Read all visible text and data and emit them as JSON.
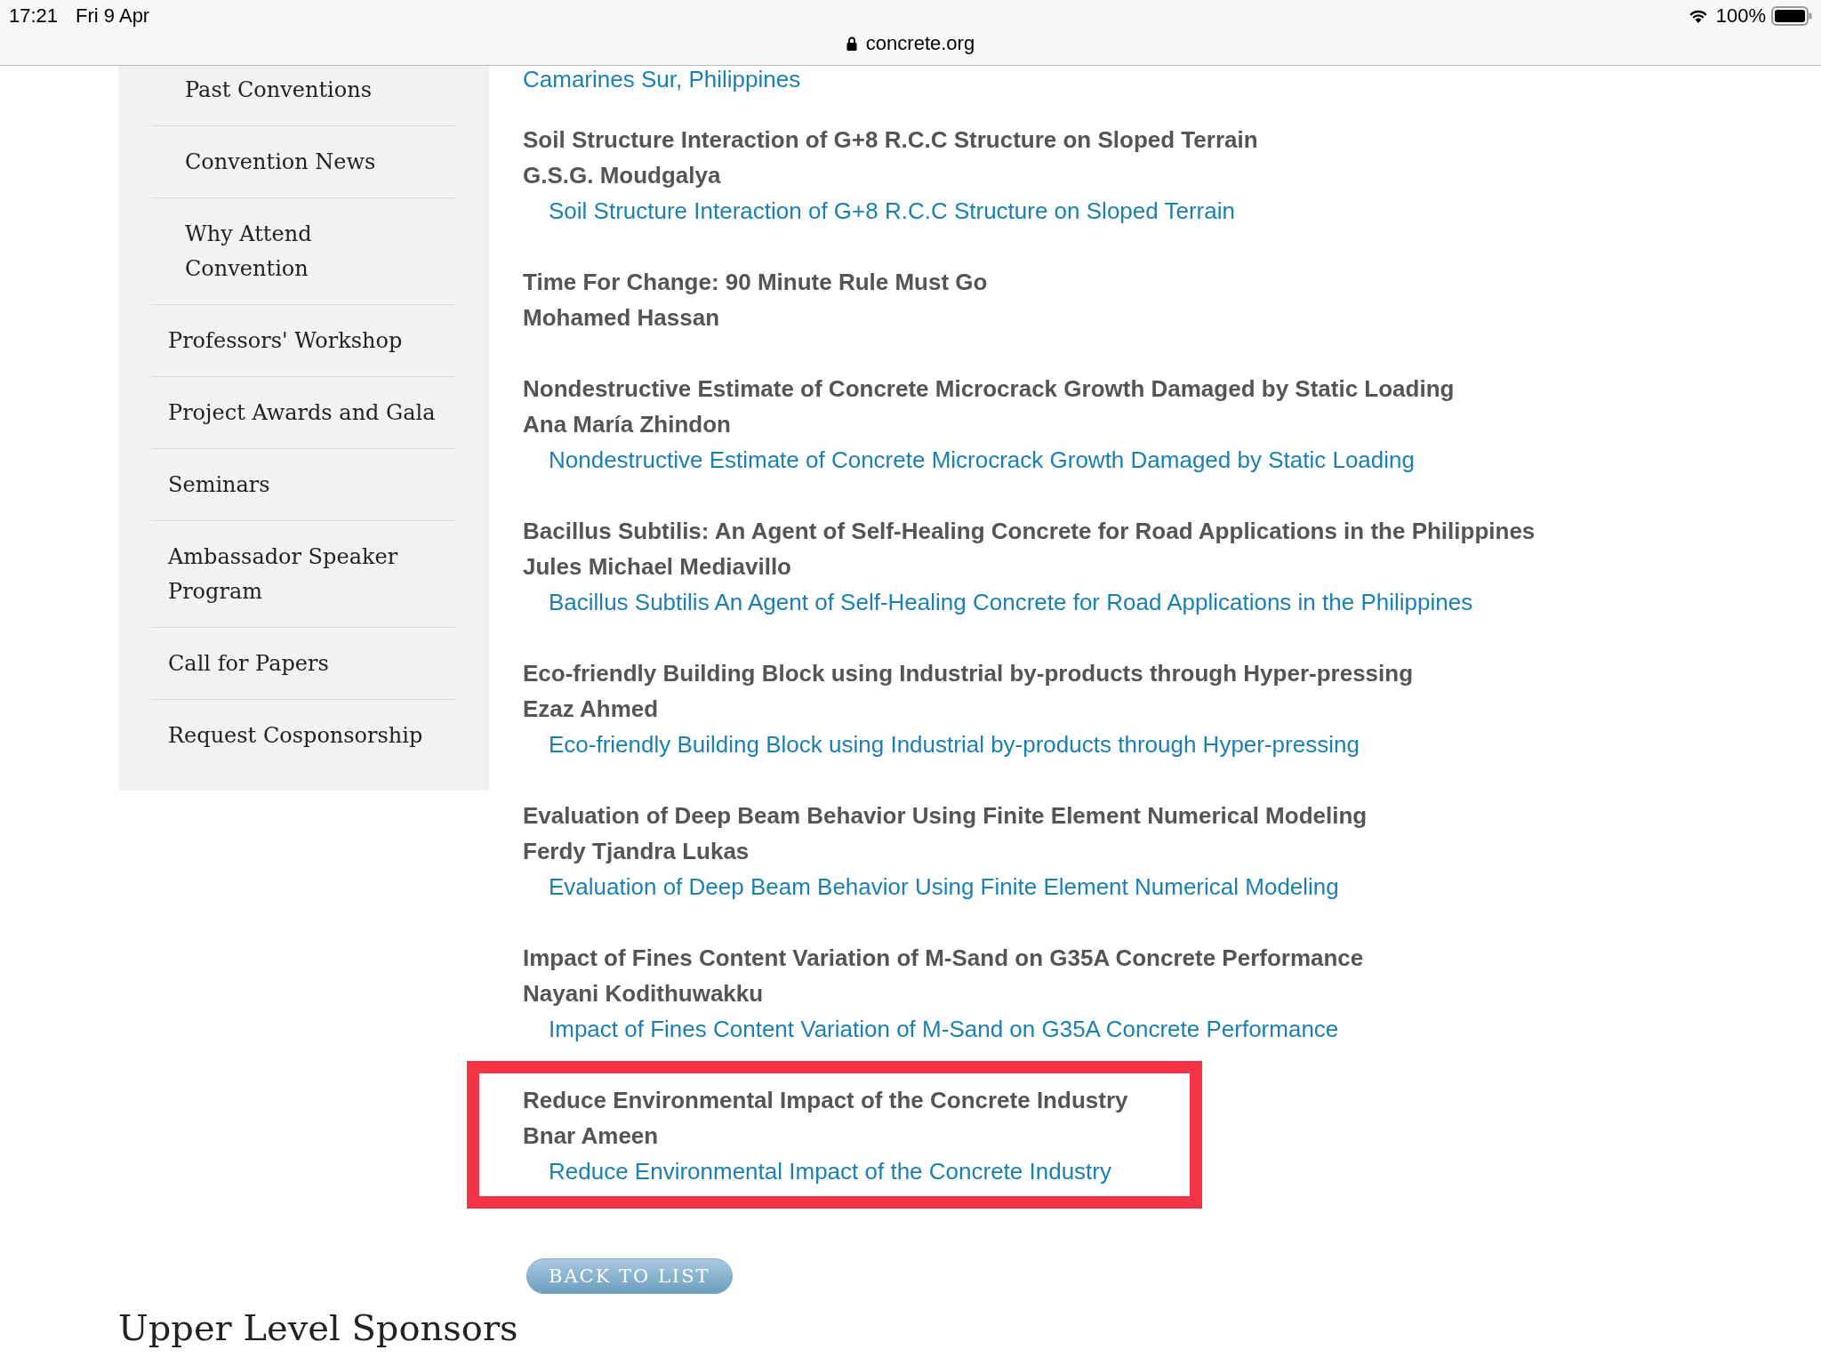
{
  "status_bar": {
    "time": "17:21",
    "date": "Fri 9 Apr",
    "battery": "100%"
  },
  "address_bar": {
    "url": "concrete.org"
  },
  "sidebar": {
    "items": [
      {
        "label": "Past Conventions",
        "kind": "subitem"
      },
      {
        "label": "Convention News",
        "kind": "subitem"
      },
      {
        "label": "Why Attend Convention",
        "kind": "subitem"
      },
      {
        "label": "Professors' Workshop",
        "kind": "item"
      },
      {
        "label": "Project Awards and Gala",
        "kind": "item"
      },
      {
        "label": "Seminars",
        "kind": "item"
      },
      {
        "label": "Ambassador Speaker Program",
        "kind": "item"
      },
      {
        "label": "Call for Papers",
        "kind": "item"
      },
      {
        "label": "Request Cosponsorship",
        "kind": "item"
      }
    ]
  },
  "cut_link": "Camarines Sur, Philippines",
  "entries": [
    {
      "title": "Soil Structure Interaction of G+8 R.C.C Structure on Sloped Terrain",
      "author": "G.S.G. Moudgalya",
      "link": "Soil Structure Interaction of G+8 R.C.C Structure on Sloped Terrain",
      "highlighted": false
    },
    {
      "title": "Time For Change: 90 Minute Rule Must Go",
      "author": "Mohamed Hassan",
      "highlighted": false
    },
    {
      "title": "Nondestructive Estimate of Concrete Microcrack Growth Damaged by Static Loading",
      "author": "Ana María Zhindon",
      "link": "Nondestructive Estimate of Concrete Microcrack Growth Damaged by Static Loading",
      "highlighted": false
    },
    {
      "title": "Bacillus Subtilis: An Agent of Self-Healing Concrete for Road Applications in the Philippines",
      "author": "Jules Michael Mediavillo",
      "link": "Bacillus Subtilis An Agent of Self-Healing Concrete for Road Applications in the Philippines",
      "highlighted": false
    },
    {
      "title": "Eco-friendly Building Block using Industrial by-products through Hyper-pressing",
      "author": "Ezaz Ahmed",
      "link": "Eco-friendly Building Block using Industrial by-products through Hyper-pressing",
      "highlighted": false
    },
    {
      "title": "Evaluation of Deep Beam Behavior Using Finite Element Numerical Modeling",
      "author": "Ferdy Tjandra Lukas",
      "link": "Evaluation of Deep Beam Behavior Using Finite Element Numerical Modeling",
      "highlighted": false
    },
    {
      "title": "Impact of Fines Content Variation of M-Sand on G35A Concrete Performance",
      "author": "Nayani Kodithuwakku",
      "link": "Impact of Fines Content Variation of M-Sand on G35A Concrete Performance",
      "highlighted": false
    },
    {
      "title": "Reduce Environmental Impact of the Concrete Industry",
      "author": "Bnar Ameen",
      "link": "Reduce Environmental Impact of the Concrete Industry",
      "highlighted": true
    }
  ],
  "back_button": "BACK TO LIST",
  "sponsors_heading": "Upper Level Sponsors"
}
